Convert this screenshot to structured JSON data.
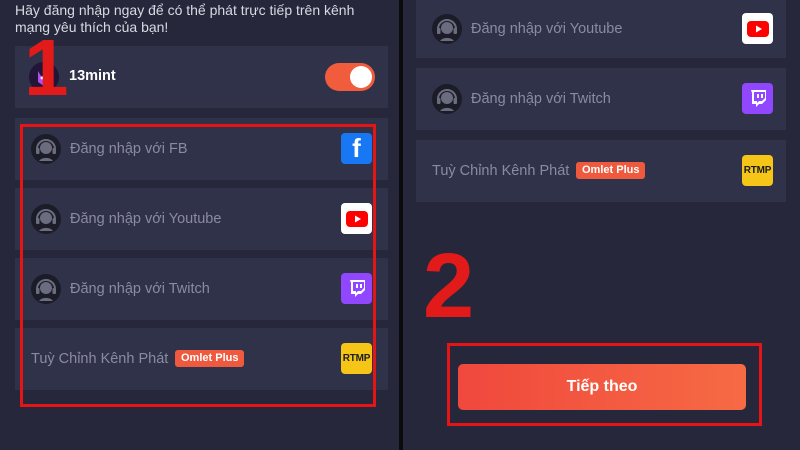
{
  "left": {
    "intro_text": "Hãy đăng nhập ngay để có thể phát trực tiếp trên kênh mạng yêu thích của bạn!",
    "account": {
      "name": "13mint",
      "toggle_on": true
    },
    "options": [
      {
        "label": "Đăng nhập với FB",
        "logo": "facebook-logo"
      },
      {
        "label": "Đăng nhập với Youtube",
        "logo": "youtube-logo"
      },
      {
        "label": "Đăng nhập với Twitch",
        "logo": "twitch-logo"
      },
      {
        "label": "Tuỳ Chỉnh Kênh Phát",
        "badge": "Omlet Plus",
        "logo_text": "RTMP"
      }
    ],
    "step_number": "1"
  },
  "right": {
    "options": [
      {
        "label": "Đăng nhập với Youtube",
        "logo": "youtube-logo"
      },
      {
        "label": "Đăng nhập với Twitch",
        "logo": "twitch-logo"
      },
      {
        "label": "Tuỳ Chỉnh Kênh Phát",
        "badge": "Omlet Plus",
        "logo_text": "RTMP"
      }
    ],
    "step_number": "2",
    "next_button_label": "Tiếp theo"
  },
  "colors": {
    "background": "#26273a",
    "card": "#30324a",
    "accent": "#f05c3c",
    "highlight": "#e51515"
  }
}
